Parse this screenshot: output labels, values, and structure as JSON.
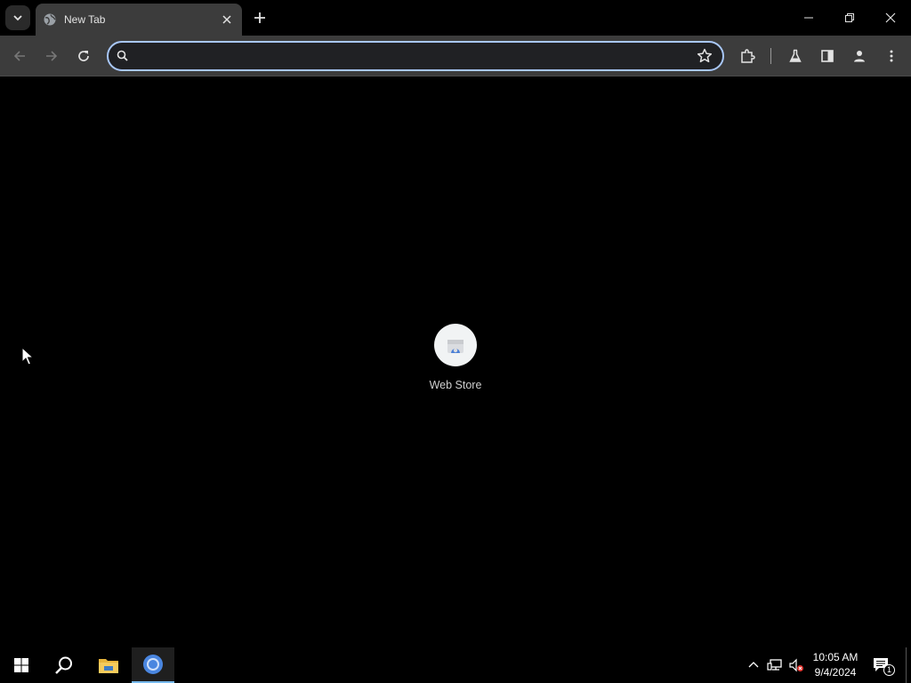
{
  "tab": {
    "title": "New Tab"
  },
  "omnibox": {
    "value": "",
    "placeholder": ""
  },
  "shortcuts": [
    {
      "label": "Web Store"
    }
  ],
  "taskbar": {
    "time": "10:05 AM",
    "date": "9/4/2024",
    "notification_count": "1"
  },
  "colors": {
    "accent": "#a8c7fa",
    "toolbar": "#3c3c3c",
    "background": "#000000"
  },
  "icons": {
    "tab_search": "chevron-down-icon",
    "favicon": "globe-icon",
    "tab_close": "close-icon",
    "new_tab": "plus-icon",
    "back": "arrow-left-icon",
    "forward": "arrow-right-icon",
    "reload": "reload-icon",
    "search": "search-icon",
    "bookmark": "star-icon",
    "extensions": "puzzle-icon",
    "labs": "flask-icon",
    "side_panel": "side-panel-icon",
    "profile": "person-icon",
    "menu": "kebab-menu-icon"
  }
}
